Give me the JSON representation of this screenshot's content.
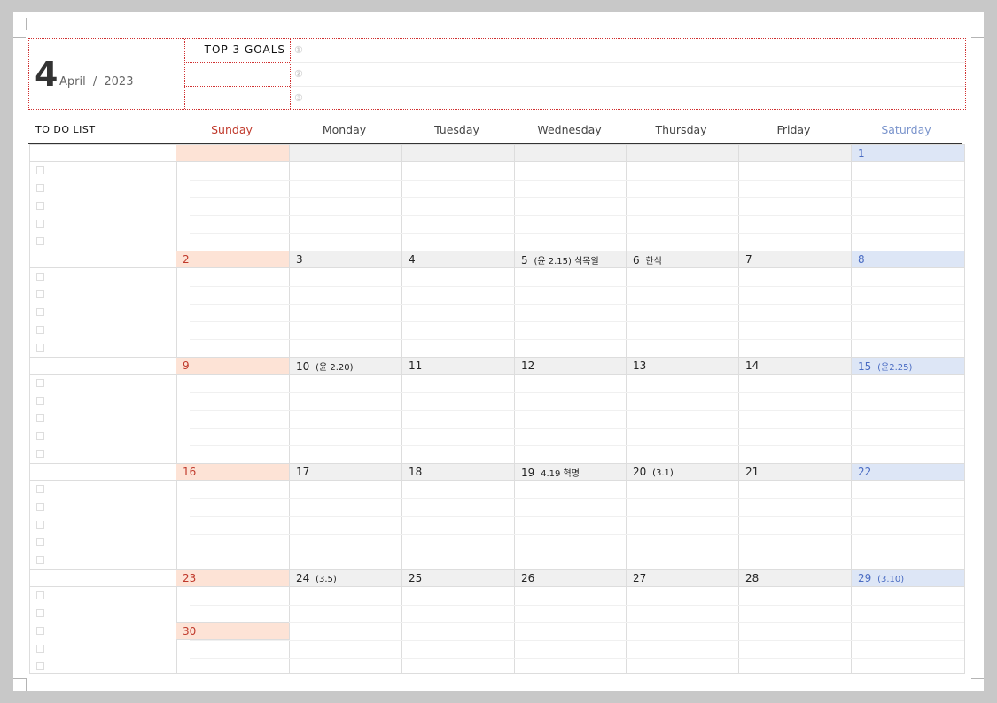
{
  "header": {
    "month_number": "4",
    "month_name": "April",
    "separator": "/",
    "year": "2023",
    "goals_title": "TOP 3 GOALS",
    "goal_markers": [
      "①",
      "②",
      "③"
    ]
  },
  "todo_title": "TO DO LIST",
  "days": [
    "Sunday",
    "Monday",
    "Tuesday",
    "Wednesday",
    "Thursday",
    "Friday",
    "Saturday"
  ],
  "colors": {
    "sunday_fill": "#fde3d6",
    "saturday_fill": "#dde6f6",
    "weekday_fill": "#f0f0f0",
    "sunday_text": "#c0392b",
    "saturday_text": "#4a6cc3",
    "border_dotted": "#d03030"
  },
  "weeks": [
    [
      {
        "day": "",
        "note": ""
      },
      {
        "day": "",
        "note": ""
      },
      {
        "day": "",
        "note": ""
      },
      {
        "day": "",
        "note": ""
      },
      {
        "day": "",
        "note": ""
      },
      {
        "day": "",
        "note": ""
      },
      {
        "day": "1",
        "note": ""
      }
    ],
    [
      {
        "day": "2",
        "note": ""
      },
      {
        "day": "3",
        "note": ""
      },
      {
        "day": "4",
        "note": ""
      },
      {
        "day": "5",
        "note": "(윤 2.15) 식목일"
      },
      {
        "day": "6",
        "note": "한식"
      },
      {
        "day": "7",
        "note": ""
      },
      {
        "day": "8",
        "note": ""
      }
    ],
    [
      {
        "day": "9",
        "note": ""
      },
      {
        "day": "10",
        "note": "(윤 2.20)"
      },
      {
        "day": "11",
        "note": ""
      },
      {
        "day": "12",
        "note": ""
      },
      {
        "day": "13",
        "note": ""
      },
      {
        "day": "14",
        "note": ""
      },
      {
        "day": "15",
        "note": "(윤2.25)"
      }
    ],
    [
      {
        "day": "16",
        "note": ""
      },
      {
        "day": "17",
        "note": ""
      },
      {
        "day": "18",
        "note": ""
      },
      {
        "day": "19",
        "note": "4.19 혁명"
      },
      {
        "day": "20",
        "note": "(3.1)"
      },
      {
        "day": "21",
        "note": ""
      },
      {
        "day": "22",
        "note": ""
      }
    ],
    [
      {
        "day": "23",
        "note": ""
      },
      {
        "day": "24",
        "note": "(3.5)"
      },
      {
        "day": "25",
        "note": ""
      },
      {
        "day": "26",
        "note": ""
      },
      {
        "day": "27",
        "note": ""
      },
      {
        "day": "28",
        "note": ""
      },
      {
        "day": "29",
        "note": "(3.10)"
      }
    ]
  ],
  "extra_day": {
    "day": "30"
  }
}
